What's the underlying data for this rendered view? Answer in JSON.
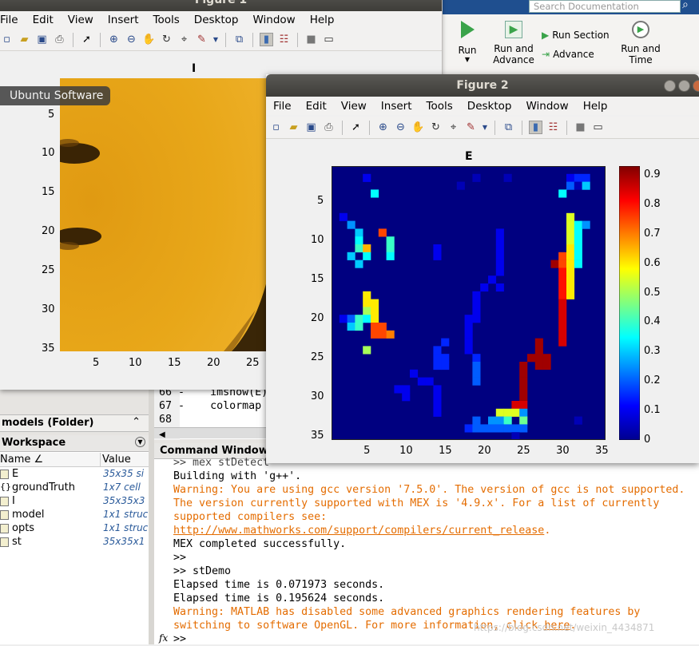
{
  "figure1": {
    "title": "Figure 1",
    "menu": [
      "File",
      "Edit",
      "View",
      "Insert",
      "Tools",
      "Desktop",
      "Window",
      "Help"
    ],
    "plot_title": "I",
    "y_ticks": [
      "5",
      "10",
      "15",
      "20",
      "25",
      "30",
      "35"
    ],
    "x_ticks": [
      "5",
      "10",
      "15",
      "20",
      "25"
    ],
    "colors": {
      "fill": "#e8a719",
      "dark": "#5a3a05"
    }
  },
  "ubuntu_tooltip": "Ubuntu Software",
  "ribbon": {
    "search_placeholder": "Search Documentation",
    "run": "Run",
    "run_and_advance_1": "Run and",
    "run_and_advance_2": "Advance",
    "run_section": "Run Section",
    "advance": "Advance",
    "run_and_time_1": "Run and",
    "run_and_time_2": "Time"
  },
  "editor": {
    "lines": [
      {
        "num": "66",
        "dash": "-",
        "code": "imshow(E);"
      },
      {
        "num": "67",
        "dash": "-",
        "code": "colormap jet"
      },
      {
        "num": "68",
        "dash": "",
        "code": ""
      }
    ]
  },
  "folder_panel": {
    "label": "models  (Folder)"
  },
  "workspace": {
    "title": "Workspace",
    "col_name": "Name ∠",
    "col_value": "Value",
    "rows": [
      {
        "name": "E",
        "value": "35x35 si"
      },
      {
        "name": "groundTruth",
        "value": "1x7 cell"
      },
      {
        "name": "I",
        "value": "35x35x3"
      },
      {
        "name": "model",
        "value": "1x1 struc"
      },
      {
        "name": "opts",
        "value": "1x1 struc"
      },
      {
        "name": "st",
        "value": "35x35x1"
      }
    ]
  },
  "command_window": {
    "title": "Command Window",
    "line1": ">> mex stDetect",
    "line2": "Building with 'g++'.",
    "warn1a": "Warning: You are using gcc version '7.5.0'. The version of gcc is not supported.",
    "warn1b": "The version currently supported with MEX is '4.9.x'. For a list of currently",
    "warn1c": "supported compilers see:",
    "link1": "http://www.mathworks.com/support/compilers/current_release",
    "link1_tail": ".",
    "line3": "MEX completed successfully.",
    "line4": ">>",
    "line5": ">> stDemo",
    "line6": "Elapsed time is 0.071973 seconds.",
    "line7": "Elapsed time is 0.195624 seconds.",
    "warn2a": "Warning: MATLAB has disabled some advanced graphics rendering features by",
    "warn2b_pre": "switching to software OpenGL. For more information, click ",
    "warn2b_link": "here",
    "warn2b_post": ".",
    "prompt": ">>",
    "fx": "fx",
    "watermark": "https://blog.csdn.net/weixin_4434871"
  },
  "figure2": {
    "title": "Figure 2",
    "menu": [
      "File",
      "Edit",
      "View",
      "Insert",
      "Tools",
      "Desktop",
      "Window",
      "Help"
    ],
    "plot_title": "E",
    "y_ticks": [
      "5",
      "10",
      "15",
      "20",
      "25",
      "30",
      "35"
    ],
    "x_ticks": [
      "5",
      "10",
      "15",
      "20",
      "25",
      "30",
      "35"
    ],
    "colorbar_ticks": [
      "0",
      "0.1",
      "0.2",
      "0.3",
      "0.4",
      "0.5",
      "0.6",
      "0.7",
      "0.8",
      "0.9"
    ]
  },
  "chart_data": {
    "type": "heatmap",
    "title": "E",
    "colormap": "jet",
    "x_range": [
      1,
      35
    ],
    "y_range": [
      1,
      35
    ],
    "clim": [
      0,
      0.93
    ],
    "background_value": 0,
    "cells": [
      [
        5,
        2,
        0.1
      ],
      [
        19,
        2,
        0.05
      ],
      [
        23,
        2,
        0.05
      ],
      [
        31,
        2,
        0.1
      ],
      [
        32,
        2,
        0.15
      ],
      [
        33,
        2,
        0.15
      ],
      [
        17,
        3,
        0.05
      ],
      [
        31,
        3,
        0.2
      ],
      [
        32,
        3,
        0.05
      ],
      [
        33,
        3,
        0.3
      ],
      [
        6,
        4,
        0.35
      ],
      [
        30,
        4,
        0.35
      ],
      [
        2,
        7,
        0.1
      ],
      [
        31,
        7,
        0.55
      ],
      [
        3,
        8,
        0.25
      ],
      [
        31,
        8,
        0.55
      ],
      [
        32,
        8,
        0.35
      ],
      [
        33,
        8,
        0.25
      ],
      [
        4,
        9,
        0.3
      ],
      [
        7,
        9,
        0.75
      ],
      [
        22,
        9,
        0.1
      ],
      [
        31,
        9,
        0.55
      ],
      [
        32,
        9,
        0.35
      ],
      [
        4,
        10,
        0.35
      ],
      [
        8,
        10,
        0.4
      ],
      [
        22,
        10,
        0.1
      ],
      [
        31,
        10,
        0.55
      ],
      [
        32,
        10,
        0.35
      ],
      [
        4,
        11,
        0.4
      ],
      [
        5,
        11,
        0.65
      ],
      [
        8,
        11,
        0.4
      ],
      [
        14,
        11,
        0.1
      ],
      [
        22,
        11,
        0.1
      ],
      [
        31,
        11,
        0.6
      ],
      [
        32,
        11,
        0.35
      ],
      [
        3,
        12,
        0.3
      ],
      [
        5,
        12,
        0.35
      ],
      [
        8,
        12,
        0.35
      ],
      [
        14,
        12,
        0.1
      ],
      [
        22,
        12,
        0.1
      ],
      [
        30,
        12,
        0.75
      ],
      [
        31,
        12,
        0.6
      ],
      [
        32,
        12,
        0.35
      ],
      [
        4,
        13,
        0.3
      ],
      [
        22,
        13,
        0.1
      ],
      [
        29,
        13,
        0.9
      ],
      [
        30,
        13,
        0.75
      ],
      [
        31,
        13,
        0.6
      ],
      [
        32,
        13,
        0.35
      ],
      [
        22,
        14,
        0.1
      ],
      [
        30,
        14,
        0.8
      ],
      [
        31,
        14,
        0.6
      ],
      [
        21,
        15,
        0.1
      ],
      [
        30,
        15,
        0.8
      ],
      [
        31,
        15,
        0.6
      ],
      [
        20,
        16,
        0.1
      ],
      [
        22,
        16,
        0.1
      ],
      [
        30,
        16,
        0.8
      ],
      [
        31,
        16,
        0.6
      ],
      [
        5,
        17,
        0.6
      ],
      [
        19,
        17,
        0.1
      ],
      [
        30,
        17,
        0.8
      ],
      [
        31,
        17,
        0.6
      ],
      [
        5,
        18,
        0.6
      ],
      [
        6,
        18,
        0.6
      ],
      [
        19,
        18,
        0.1
      ],
      [
        30,
        18,
        0.85
      ],
      [
        5,
        19,
        0.5
      ],
      [
        6,
        19,
        0.6
      ],
      [
        19,
        19,
        0.1
      ],
      [
        30,
        19,
        0.85
      ],
      [
        2,
        20,
        0.1
      ],
      [
        3,
        20,
        0.2
      ],
      [
        4,
        20,
        0.4
      ],
      [
        5,
        20,
        0.35
      ],
      [
        6,
        20,
        0.6
      ],
      [
        18,
        20,
        0.1
      ],
      [
        19,
        20,
        0.1
      ],
      [
        30,
        20,
        0.85
      ],
      [
        3,
        21,
        0.3
      ],
      [
        4,
        21,
        0.4
      ],
      [
        6,
        21,
        0.75
      ],
      [
        7,
        21,
        0.75
      ],
      [
        18,
        21,
        0.1
      ],
      [
        30,
        21,
        0.85
      ],
      [
        6,
        22,
        0.75
      ],
      [
        7,
        22,
        0.75
      ],
      [
        8,
        22,
        0.7
      ],
      [
        18,
        22,
        0.1
      ],
      [
        30,
        22,
        0.85
      ],
      [
        15,
        23,
        0.15
      ],
      [
        18,
        23,
        0.1
      ],
      [
        27,
        23,
        0.9
      ],
      [
        30,
        23,
        0.85
      ],
      [
        5,
        24,
        0.5
      ],
      [
        14,
        24,
        0.15
      ],
      [
        18,
        24,
        0.1
      ],
      [
        27,
        24,
        0.9
      ],
      [
        14,
        25,
        0.15
      ],
      [
        15,
        25,
        0.15
      ],
      [
        19,
        25,
        0.15
      ],
      [
        26,
        25,
        0.9
      ],
      [
        27,
        25,
        0.9
      ],
      [
        28,
        25,
        0.9
      ],
      [
        14,
        26,
        0.15
      ],
      [
        15,
        26,
        0.15
      ],
      [
        19,
        26,
        0.2
      ],
      [
        25,
        26,
        0.9
      ],
      [
        27,
        26,
        0.9
      ],
      [
        28,
        26,
        0.9
      ],
      [
        11,
        27,
        0.1
      ],
      [
        19,
        27,
        0.2
      ],
      [
        25,
        27,
        0.9
      ],
      [
        12,
        28,
        0.1
      ],
      [
        13,
        28,
        0.1
      ],
      [
        19,
        28,
        0.2
      ],
      [
        25,
        28,
        0.9
      ],
      [
        9,
        29,
        0.1
      ],
      [
        10,
        29,
        0.1
      ],
      [
        14,
        29,
        0.1
      ],
      [
        25,
        29,
        0.9
      ],
      [
        10,
        30,
        0.1
      ],
      [
        14,
        30,
        0.1
      ],
      [
        25,
        30,
        0.9
      ],
      [
        14,
        31,
        0.1
      ],
      [
        24,
        31,
        0.85
      ],
      [
        25,
        31,
        0.85
      ],
      [
        14,
        32,
        0.1
      ],
      [
        22,
        32,
        0.55
      ],
      [
        23,
        32,
        0.55
      ],
      [
        24,
        32,
        0.55
      ],
      [
        25,
        32,
        0.25
      ],
      [
        19,
        33,
        0.2
      ],
      [
        21,
        33,
        0.25
      ],
      [
        22,
        33,
        0.25
      ],
      [
        23,
        33,
        0.4
      ],
      [
        25,
        33,
        0.45
      ],
      [
        32,
        33,
        0.05
      ],
      [
        18,
        34,
        0.15
      ],
      [
        19,
        34,
        0.2
      ],
      [
        20,
        34,
        0.2
      ],
      [
        21,
        34,
        0.2
      ],
      [
        22,
        34,
        0.2
      ],
      [
        23,
        34,
        0.2
      ],
      [
        24,
        34,
        0.2
      ],
      [
        25,
        34,
        0.2
      ],
      [
        24,
        35,
        0.05
      ]
    ]
  }
}
